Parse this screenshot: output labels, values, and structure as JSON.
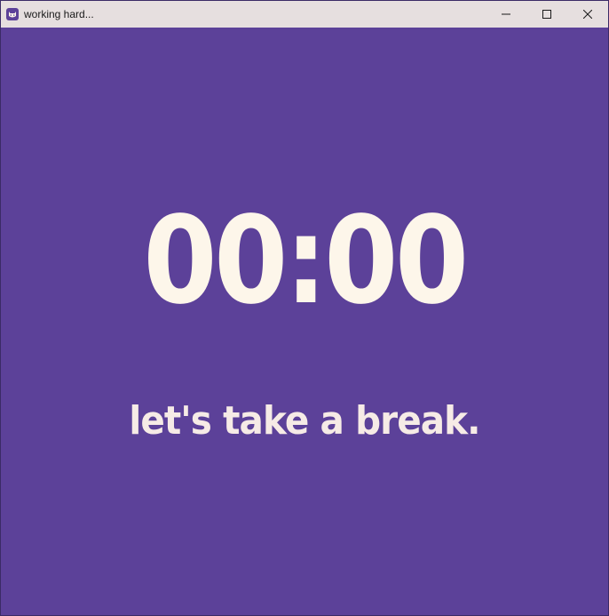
{
  "window": {
    "title": "working hard...",
    "icons": {
      "app": "cat-face-icon",
      "minimize": "minimize-icon",
      "maximize": "maximize-icon",
      "close": "close-icon"
    }
  },
  "timer": {
    "display": "00:00",
    "message": "let's take a break."
  },
  "colors": {
    "background": "#5c4199",
    "timer_text": "#fdf6ea",
    "message_text": "#f6ebe6",
    "titlebar": "#e6dfdf"
  }
}
